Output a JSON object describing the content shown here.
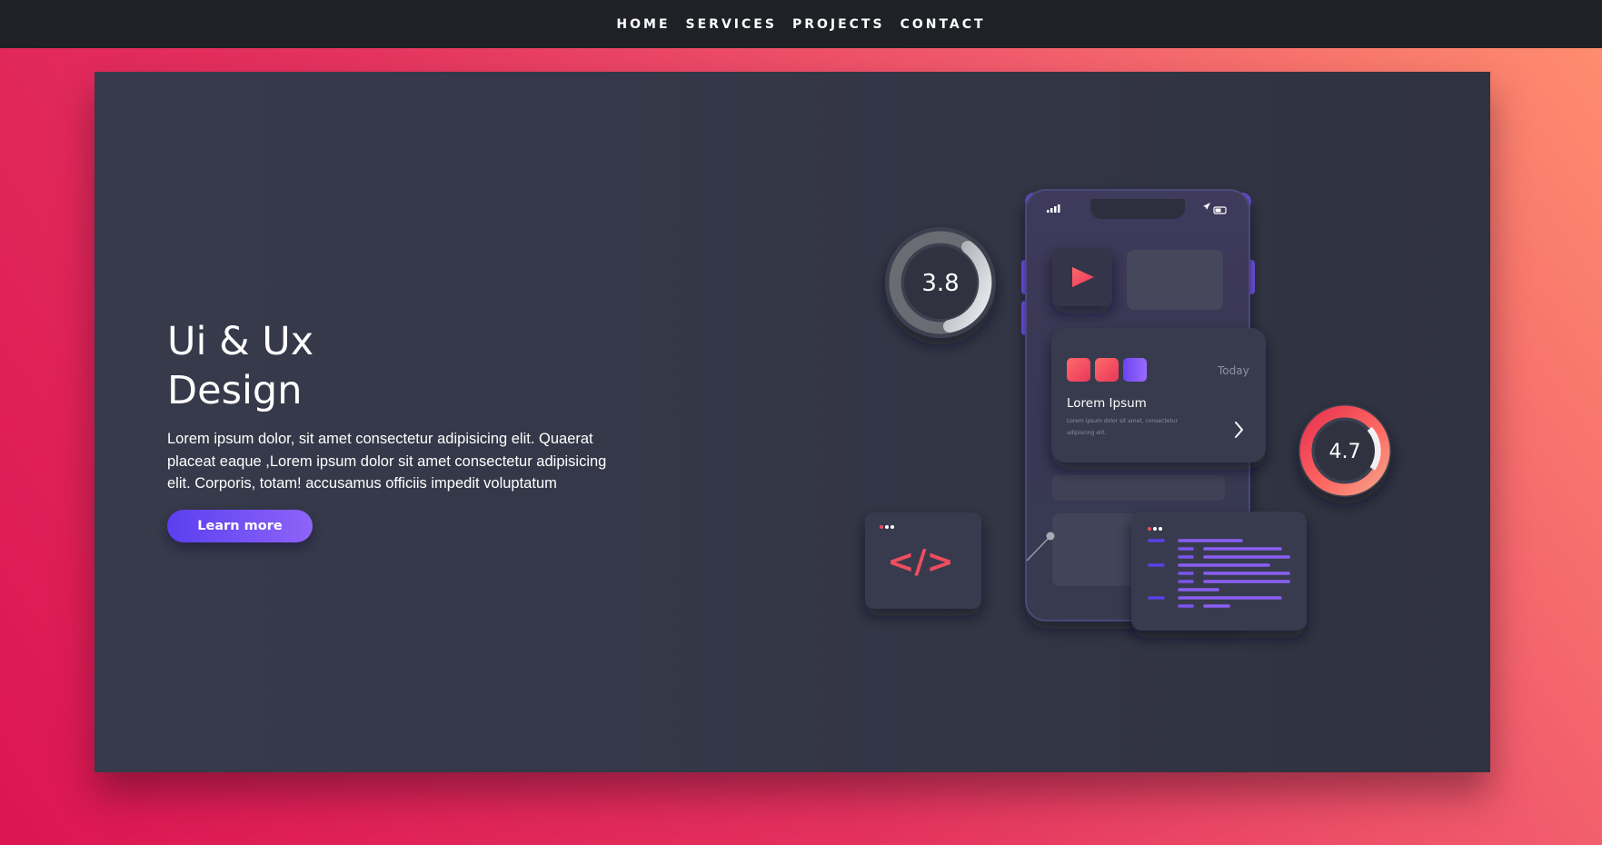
{
  "nav": {
    "items": [
      "HOME",
      "SERVICES",
      "PROJECTS",
      "CONTACT"
    ]
  },
  "hero": {
    "title_line1": "Ui & Ux",
    "title_line2": "Design",
    "description": "Lorem ipsum dolor, sit amet consectetur adipisicing elit. Quaerat placeat eaque ,Lorem ipsum dolor sit amet consectetur adipisicing elit. Corporis, totam! accusamus officiis impedit voluptatum",
    "button_label": "Learn more"
  },
  "illustration": {
    "rating_left": "3.8",
    "rating_right": "4.7",
    "card_day": "Today",
    "card_title": "Lorem Ipsum",
    "card_text_line1": "Lorem ipsum dolor sit amet, consectetur",
    "card_text_line2": "adipiscing elit.",
    "code_symbol": "</>"
  },
  "colors": {
    "nav_bg": "#1f2127",
    "card_bg": "#353848",
    "accent_purple": "#7b52f5",
    "accent_red": "#ef4d5f",
    "gradient_top_right": "#ff8f6e",
    "gradient_bottom_left": "#dc1552"
  }
}
